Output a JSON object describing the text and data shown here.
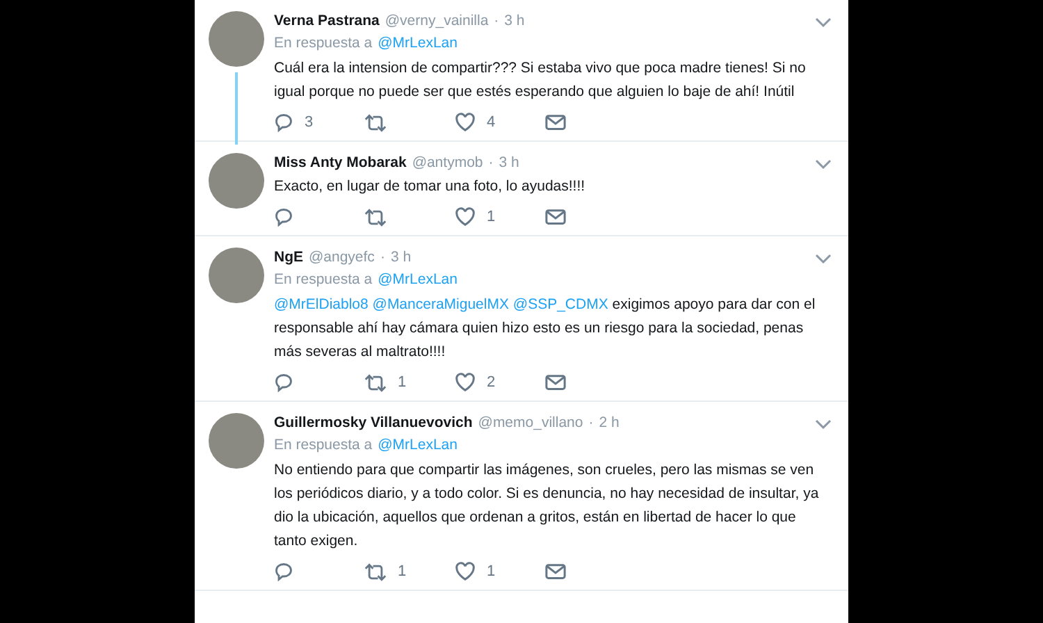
{
  "tweets": [
    {
      "name": "Verna Pastrana",
      "handle": "@verny_vainilla",
      "separator": "·",
      "time": "3 h",
      "reply_prefix": "En respuesta a",
      "reply_to": "@MrLexLan",
      "thread": true,
      "body": [
        {
          "kind": "text",
          "text": "Cuál era la intension de compartir??? Si estaba vivo que poca madre tienes! Si no igual porque no puede ser que estés esperando que alguien lo baje de ahí! Inútil"
        }
      ],
      "replies": "3",
      "likes": "4"
    },
    {
      "name": "Miss Anty Mobarak",
      "handle": "@antymob",
      "separator": "·",
      "time": "3 h",
      "thread": false,
      "body": [
        {
          "kind": "text",
          "text": "Exacto, en lugar de tomar una foto, lo ayudas!!!!"
        }
      ],
      "likes": "1"
    },
    {
      "name": "NgE",
      "handle": "@angyefc",
      "separator": "·",
      "time": "3 h",
      "reply_prefix": "En respuesta a",
      "reply_to": "@MrLexLan",
      "thread": false,
      "body": [
        {
          "kind": "mention",
          "text": "@MrElDiablo8"
        },
        {
          "kind": "mention",
          "text": "@ManceraMiguelMX"
        },
        {
          "kind": "mention",
          "text": "@SSP_CDMX"
        },
        {
          "kind": "text",
          "text": " exigimos apoyo para dar con el responsable ahí hay cámara quien hizo esto es un riesgo para la sociedad, penas más severas al maltrato!!!!"
        }
      ],
      "retweets": "1",
      "likes": "2"
    },
    {
      "name": "Guillermosky Villanuevovich",
      "handle": "@memo_villano",
      "separator": "·",
      "time": "2 h",
      "reply_prefix": "En respuesta a",
      "reply_to": "@MrLexLan",
      "thread": false,
      "body": [
        {
          "kind": "text",
          "text": "No entiendo para que compartir las imágenes, son crueles, pero las mismas se ven los periódicos diario, y a todo color. Si es denuncia,  no hay necesidad de insultar, ya dio la ubicación, aquellos que ordenan a gritos, están en libertad de hacer lo que tanto exigen."
        }
      ],
      "retweets": "1",
      "likes": "1"
    }
  ]
}
